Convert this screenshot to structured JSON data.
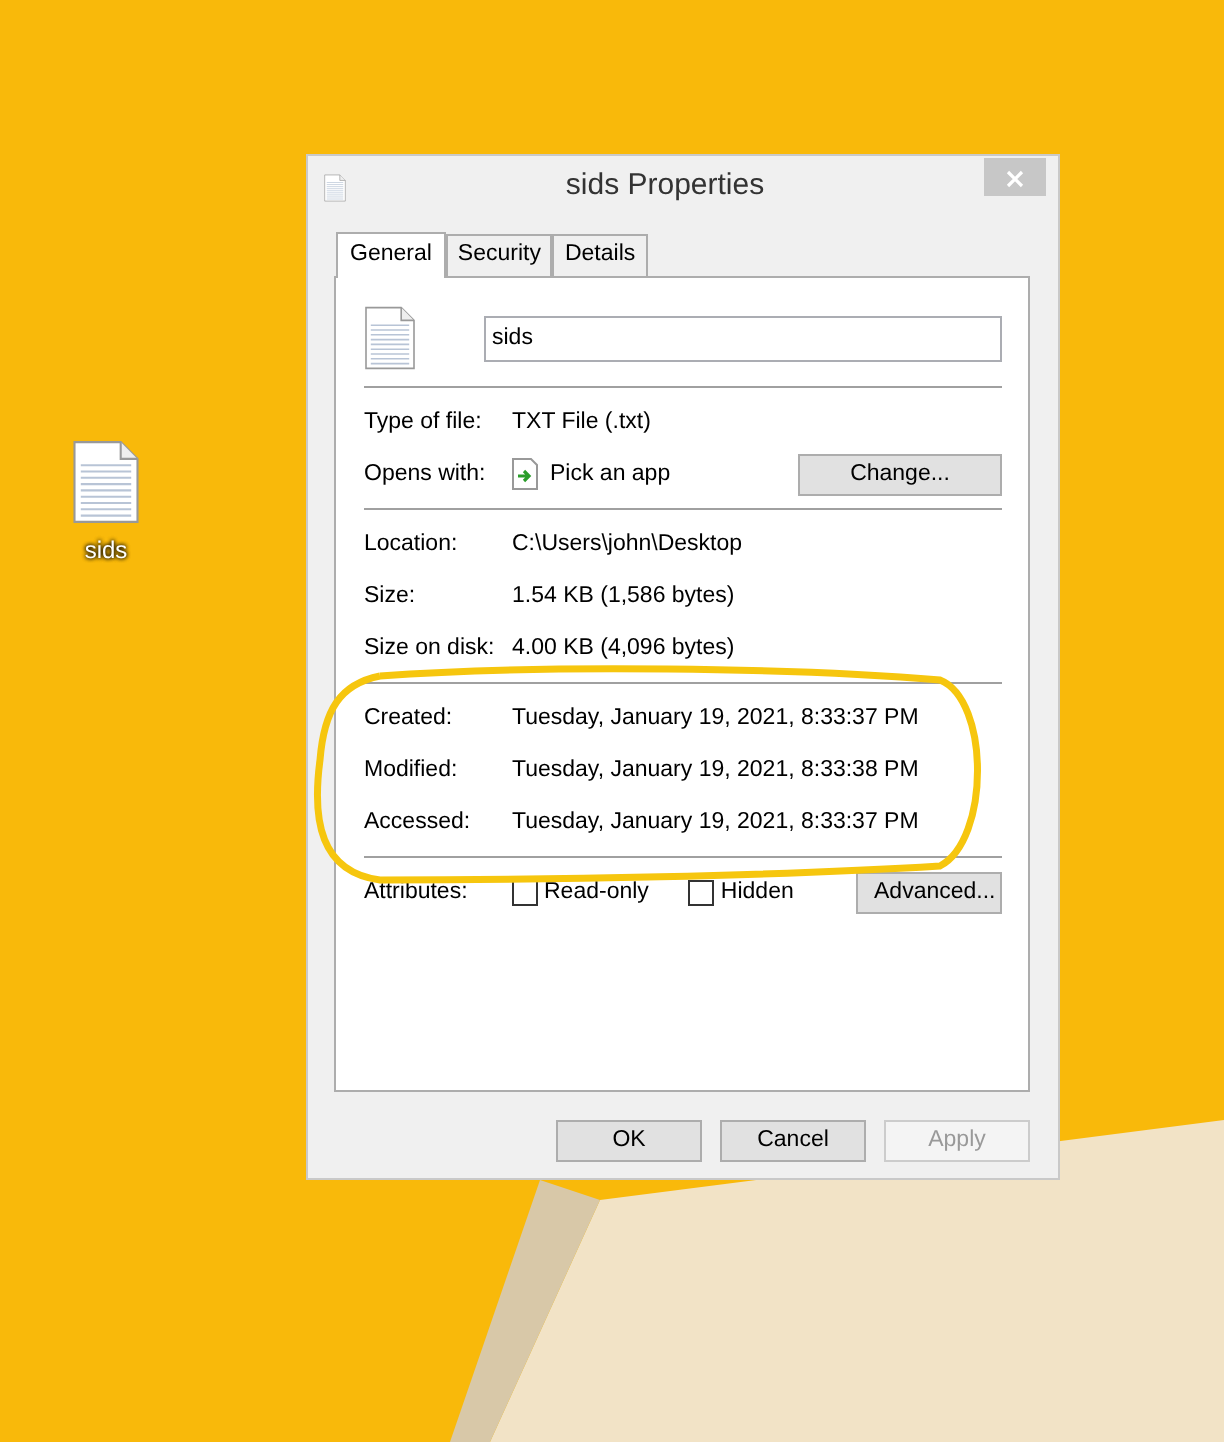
{
  "desktop_icon": {
    "label": "sids"
  },
  "window": {
    "title": "sids Properties"
  },
  "tabs": [
    {
      "label": "General",
      "selected": true
    },
    {
      "label": "Security",
      "selected": false
    },
    {
      "label": "Details",
      "selected": false
    }
  ],
  "file_name": {
    "value": "sids"
  },
  "sections": [
    [
      {
        "label": "Type of file:",
        "value": "TXT File (.txt)"
      },
      {
        "label": "Opens with:",
        "value": "Pick an app",
        "kind": "app",
        "button": "Change..."
      }
    ],
    [
      {
        "label": "Location:",
        "value": "C:\\Users\\john\\Desktop"
      },
      {
        "label": "Size:",
        "value": "1.54 KB (1,586 bytes)"
      },
      {
        "label": "Size on disk:",
        "value": "4.00 KB (4,096 bytes)"
      }
    ],
    [
      {
        "label": "Created:",
        "value": "Tuesday, January 19, 2021, 8:33:37 PM"
      },
      {
        "label": "Modified:",
        "value": "Tuesday, January 19, 2021, 8:33:38 PM"
      },
      {
        "label": "Accessed:",
        "value": "Tuesday, January 19, 2021, 8:33:37 PM"
      }
    ]
  ],
  "attributes": {
    "label": "Attributes:",
    "options": [
      {
        "label": "Read-only",
        "checked": false
      },
      {
        "label": "Hidden",
        "checked": false
      }
    ],
    "button": "Advanced..."
  },
  "buttons": [
    {
      "label": "OK",
      "disabled": false
    },
    {
      "label": "Cancel",
      "disabled": false
    },
    {
      "label": "Apply",
      "disabled": true
    }
  ]
}
